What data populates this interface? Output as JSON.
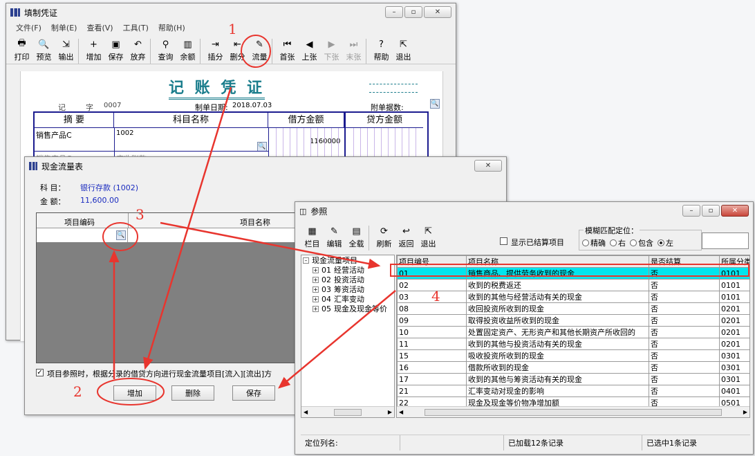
{
  "voucher_window": {
    "title": "填制凭证",
    "menu": [
      "文件(F)",
      "制单(E)",
      "查看(V)",
      "工具(T)",
      "帮助(H)"
    ],
    "toolbar": [
      {
        "label": "打印",
        "icon": "printer-icon",
        "glyph": "🖶",
        "enabled": true
      },
      {
        "label": "预览",
        "icon": "preview-icon",
        "glyph": "🔍",
        "enabled": true
      },
      {
        "label": "输出",
        "icon": "export-icon",
        "glyph": "⇲",
        "enabled": true
      },
      {
        "label": "增加",
        "icon": "add-icon",
        "glyph": "+",
        "enabled": true
      },
      {
        "label": "保存",
        "icon": "save-icon",
        "glyph": "▣",
        "enabled": true
      },
      {
        "label": "放弃",
        "icon": "undo-icon",
        "glyph": "↶",
        "enabled": true
      },
      {
        "label": "查询",
        "icon": "binoculars-icon",
        "glyph": "⚲",
        "enabled": true
      },
      {
        "label": "余额",
        "icon": "bar-chart-icon",
        "glyph": "▥",
        "enabled": true
      },
      {
        "label": "插分",
        "icon": "insert-row-icon",
        "glyph": "⇥",
        "enabled": true
      },
      {
        "label": "删分",
        "icon": "delete-row-icon",
        "glyph": "⇤",
        "enabled": true
      },
      {
        "label": "流量",
        "icon": "cashflow-icon",
        "glyph": "✎",
        "enabled": true
      },
      {
        "label": "首张",
        "icon": "first-icon",
        "glyph": "⏮",
        "enabled": true
      },
      {
        "label": "上张",
        "icon": "previous-icon",
        "glyph": "◀",
        "enabled": true
      },
      {
        "label": "下张",
        "icon": "next-icon",
        "glyph": "▶",
        "enabled": false
      },
      {
        "label": "末张",
        "icon": "last-icon",
        "glyph": "⏭",
        "enabled": false
      },
      {
        "label": "帮助",
        "icon": "help-icon",
        "glyph": "?",
        "enabled": true
      },
      {
        "label": "退出",
        "icon": "exit-icon",
        "glyph": "⇱",
        "enabled": true
      }
    ],
    "voucher_title": "记 账 凭 证",
    "voucher_type": "记",
    "voucher_no_label": "字",
    "voucher_no": "0007",
    "date_label": "制单日期:",
    "date": "2018.07.03",
    "attachments_label": "附单据数:",
    "columns": [
      "摘 要",
      "科目名称",
      "借方金额",
      "贷方金额"
    ],
    "row1": {
      "summary": "销售产品C",
      "account": "1002",
      "debit": "1160000"
    },
    "row2": {
      "summary": "销售产品C",
      "account": "应收账款"
    }
  },
  "cashflow_window": {
    "title": "现金流量表",
    "account_label": "科 目：",
    "account_value": "银行存款 (1002)",
    "amount_label": "金 额：",
    "amount_value": "11,600.00",
    "col_code": "项目编码",
    "col_name": "项目名称",
    "checkbox_label": "项目参照时，根据分录的借贷方向进行现金流量项目[流入][流出]方",
    "checkbox_checked": true,
    "buttons": [
      "增加",
      "删除",
      "保存"
    ]
  },
  "reference_window": {
    "title": "参照",
    "toolbar": [
      {
        "label": "栏目",
        "icon": "columns-icon",
        "glyph": "▦"
      },
      {
        "label": "编辑",
        "icon": "edit-icon",
        "glyph": "✎"
      },
      {
        "label": "全载",
        "icon": "load-all-icon",
        "glyph": "▤"
      },
      {
        "label": "刷新",
        "icon": "refresh-icon",
        "glyph": "⟳"
      },
      {
        "label": "返回",
        "icon": "return-icon",
        "glyph": "↩"
      },
      {
        "label": "退出",
        "icon": "exit-icon",
        "glyph": "⇱"
      }
    ],
    "show_closed_label": "显示已结算项目",
    "fuzzy_label": "模糊匹配定位：",
    "fuzzy_options": [
      "精确",
      "右",
      "包含",
      "左"
    ],
    "fuzzy_selected": "左",
    "tree_root": "现金流量项目",
    "tree": [
      {
        "code": "01",
        "name": "经营活动"
      },
      {
        "code": "02",
        "name": "投资活动"
      },
      {
        "code": "03",
        "name": "筹资活动"
      },
      {
        "code": "04",
        "name": "汇率变动"
      },
      {
        "code": "05",
        "name": "现金及现金等价"
      }
    ],
    "columns": [
      "项目编号",
      "项目名称",
      "是否结算",
      "所属分类"
    ],
    "rows": [
      {
        "code": "01",
        "name": "销售商品、提供劳务收到的现金",
        "settled": "否",
        "cat": "0101",
        "selected": true
      },
      {
        "code": "02",
        "name": "收到的税费返还",
        "settled": "否",
        "cat": "0101"
      },
      {
        "code": "03",
        "name": "收到的其他与经营活动有关的现金",
        "settled": "否",
        "cat": "0101"
      },
      {
        "code": "08",
        "name": "收回投资所收到的现金",
        "settled": "否",
        "cat": "0201"
      },
      {
        "code": "09",
        "name": "取得投资收益所收到的现金",
        "settled": "否",
        "cat": "0201"
      },
      {
        "code": "10",
        "name": "处置固定资产、无形资产和其他长期资产所收回的",
        "settled": "否",
        "cat": "0201"
      },
      {
        "code": "11",
        "name": "收到的其他与投资活动有关的现金",
        "settled": "否",
        "cat": "0201"
      },
      {
        "code": "15",
        "name": "吸收投资所收到的现金",
        "settled": "否",
        "cat": "0301"
      },
      {
        "code": "16",
        "name": "借款所收到的现金",
        "settled": "否",
        "cat": "0301"
      },
      {
        "code": "17",
        "name": "收到的其他与筹资活动有关的现金",
        "settled": "否",
        "cat": "0301"
      },
      {
        "code": "21",
        "name": "汇率变动对现金的影响",
        "settled": "否",
        "cat": "0401"
      },
      {
        "code": "22",
        "name": "现金及现金等价物净增加额",
        "settled": "否",
        "cat": "0501"
      }
    ],
    "status_locate": "定位列名:",
    "status_loaded": "已加载12条记录",
    "status_selected": "已选中1条记录"
  },
  "annotations": [
    "1",
    "2",
    "3",
    "4"
  ],
  "colors": {
    "annotation": "#e8352e",
    "selected_row": "#00e5ee",
    "blue_text": "#1a2bbf"
  }
}
